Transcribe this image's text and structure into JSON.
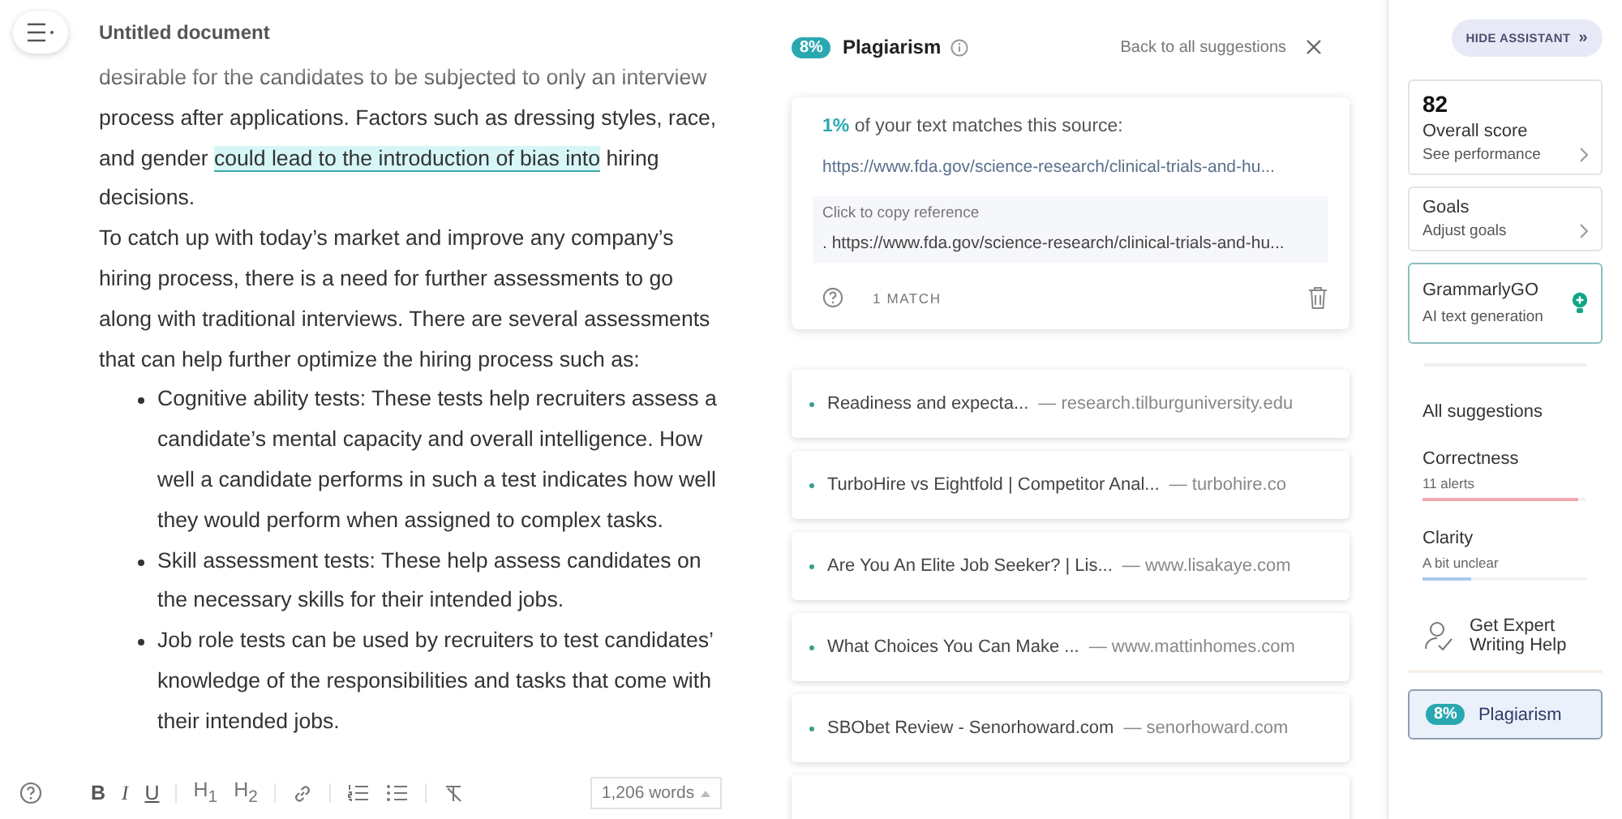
{
  "document": {
    "title": "Untitled document",
    "blocks": [
      {
        "kind": "para",
        "before": "desirable for the candidates to be subjected to only an interview process after applications. Factors such as dressing styles, race, and gender ",
        "highlight": "could lead to the introduction of bias into",
        "after": " hiring decisions."
      },
      {
        "kind": "para",
        "before": "To catch up with today’s market and improve any company’s hiring process, there is a need for further assessments to go along with traditional interviews. There are several assessments that can help further optimize the hiring process such as:"
      },
      {
        "kind": "bullet",
        "before": "Cognitive ability tests: These tests help recruiters assess a candidate’s mental capacity and overall intelligence. How well a candidate performs in such a test indicates how well they would perform when assigned to complex tasks."
      },
      {
        "kind": "bullet",
        "before": "Skill assessment tests: These help assess candidates on the necessary skills for their intended jobs."
      },
      {
        "kind": "bullet",
        "before": "Job role tests can be used by recruiters to test candidates’ knowledge of the responsibilities and tasks that come with their intended jobs."
      }
    ]
  },
  "toolbar": {
    "buttons": [
      {
        "kind": "bold",
        "label": "B"
      },
      {
        "kind": "italic",
        "label": "I"
      },
      {
        "kind": "underline",
        "label": "U"
      },
      {
        "kind": "sep"
      },
      {
        "kind": "heading",
        "label": "H$_{1}$"
      },
      {
        "kind": "heading",
        "label": "H$_{2}$"
      },
      {
        "kind": "sep"
      },
      {
        "kind": "link"
      },
      {
        "kind": "sep"
      },
      {
        "kind": "ordered"
      },
      {
        "kind": "bulleted"
      },
      {
        "kind": "sep"
      },
      {
        "kind": "clear"
      }
    ],
    "word_count": "1,206 words"
  },
  "plagiarism": {
    "badge": "8%",
    "title": "Plagiarism",
    "back": "Back to all suggestions",
    "match": {
      "percent": "1%",
      "text": " of your text matches this source:",
      "url": "https://www.fda.gov/science-research/clinical-trials-and-hu...",
      "copy_label": "Click to copy reference",
      "reference": ". https://www.fda.gov/science-research/clinical-trials-and-hu...",
      "count": "1 MATCH"
    },
    "sources": [
      {
        "kind": "source",
        "title": "Readiness and expecta...",
        "domain": "— research.tilburguniversity.edu"
      },
      {
        "kind": "source",
        "title": "TurboHire vs Eightfold | Competitor Anal...",
        "domain": "— turbohire.co"
      },
      {
        "kind": "source",
        "title": "Are You An Elite Job Seeker? | Lis...",
        "domain": "— www.lisakaye.com"
      },
      {
        "kind": "source",
        "title": "What Choices You Can Make ...",
        "domain": "— www.mattinhomes.com"
      },
      {
        "kind": "source",
        "title": "SBObet Review - Senorhoward.com",
        "domain": "— senorhoward.com"
      },
      {
        "kind": "cut"
      }
    ]
  },
  "sidebar": {
    "hide_button": "HIDE ASSISTANT",
    "hide_arrow": "»",
    "score": {
      "value": "82",
      "label": "Overall score",
      "link": "See performance"
    },
    "goals": {
      "label": "Goals",
      "link": "Adjust goals"
    },
    "go": {
      "label": "GrammarlyGO",
      "sub": "AI text generation"
    },
    "items": [
      {
        "kind": "nav",
        "label": "All suggestions",
        "selected": false
      },
      {
        "kind": "category",
        "label": "Correctness",
        "sub": "11 alerts",
        "color": "#f1a7b0",
        "level": 0.95,
        "selected": false
      },
      {
        "kind": "category",
        "label": "Clarity",
        "sub": "A bit unclear",
        "color": "#a9c9ee",
        "level": 0.3,
        "selected": false
      },
      {
        "kind": "expert",
        "label": "Get Expert Writing Help",
        "selected": false
      },
      {
        "kind": "plagiarism",
        "badge": "8%",
        "label": "Plagiarism",
        "selected": true
      }
    ]
  }
}
